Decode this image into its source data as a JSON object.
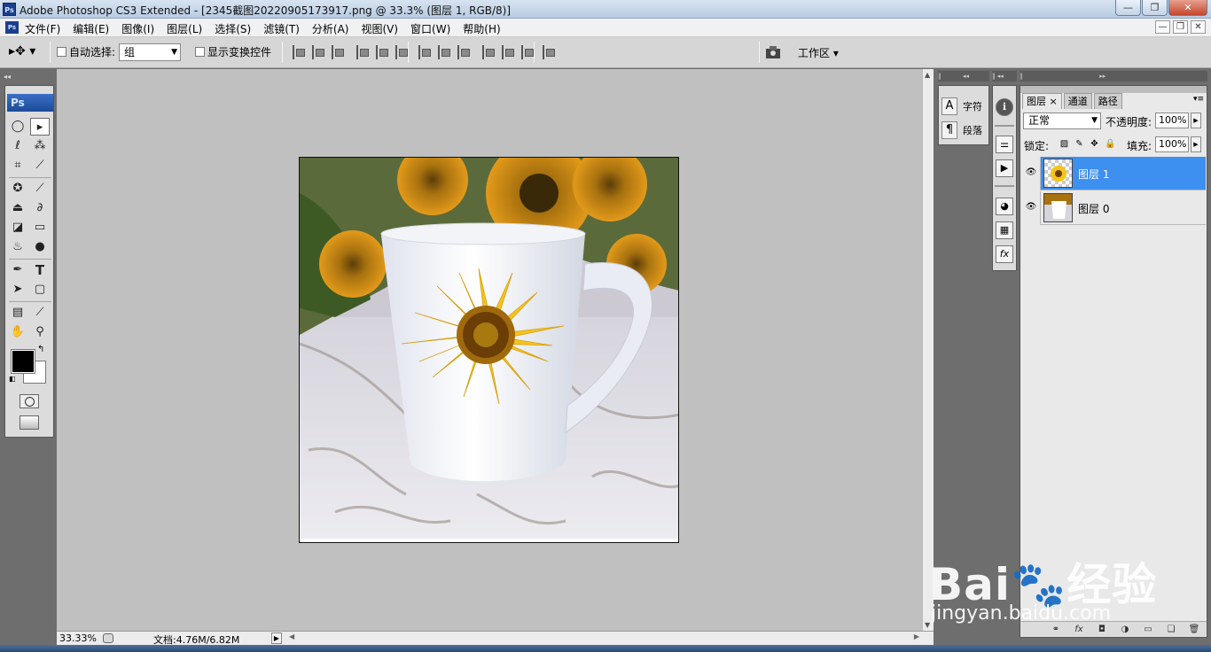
{
  "window": {
    "title": "Adobe Photoshop CS3 Extended - [2345截图20220905173917.png @ 33.3% (图层 1, RGB/8)]",
    "app_badge": "Ps",
    "minimize_label": "—",
    "restore_label": "❐",
    "close_label": "✕"
  },
  "menubar": {
    "items": [
      "文件(F)",
      "编辑(E)",
      "图像(I)",
      "图层(L)",
      "选择(S)",
      "滤镜(T)",
      "分析(A)",
      "视图(V)",
      "窗口(W)",
      "帮助(H)"
    ],
    "doc_minimize": "—",
    "doc_restore": "❐",
    "doc_close": "✕"
  },
  "options": {
    "tool_glyph": "▸✥ ▾",
    "auto_select_label": "自动选择:",
    "auto_select_value": "组",
    "show_transform_label": "显示变换控件",
    "workspace_label": "工作区 ▾"
  },
  "toolbox": {
    "logo": "Ps",
    "tools": [
      {
        "name": "marquee",
        "glyph": "◯"
      },
      {
        "name": "move",
        "glyph": "▸"
      },
      {
        "name": "lasso",
        "glyph": "ℓ"
      },
      {
        "name": "magic-wand",
        "glyph": "⁂"
      },
      {
        "name": "crop",
        "glyph": "⌗"
      },
      {
        "name": "slice",
        "glyph": "⟋"
      },
      {
        "name": "healing",
        "glyph": "✪"
      },
      {
        "name": "brush",
        "glyph": "⟋"
      },
      {
        "name": "clone-stamp",
        "glyph": "⏏"
      },
      {
        "name": "history-brush",
        "glyph": "∂"
      },
      {
        "name": "eraser",
        "glyph": "◪"
      },
      {
        "name": "gradient",
        "glyph": "▭"
      },
      {
        "name": "blur",
        "glyph": "♨"
      },
      {
        "name": "dodge",
        "glyph": "●"
      },
      {
        "name": "pen",
        "glyph": "✒"
      },
      {
        "name": "type",
        "glyph": "T"
      },
      {
        "name": "path-select",
        "glyph": "➤"
      },
      {
        "name": "shape",
        "glyph": "▢"
      },
      {
        "name": "notes",
        "glyph": "▤"
      },
      {
        "name": "eyedropper",
        "glyph": "⟋"
      },
      {
        "name": "hand",
        "glyph": "✋"
      },
      {
        "name": "zoom",
        "glyph": "⚲"
      }
    ],
    "swap_glyph": "↰",
    "default_glyph": "◧",
    "foreground_color": "#000000",
    "background_color": "#ffffff"
  },
  "status": {
    "zoom": "33.33%",
    "doc_size": "文档:4.76M/6.82M",
    "arrow": "▶"
  },
  "char_panel": {
    "character_label": "字符",
    "paragraph_label": "段落",
    "character_glyph": "A",
    "paragraph_glyph": "¶"
  },
  "icon_strip": {
    "info_glyph": "ℹ",
    "glyphs": [
      "⚌",
      "▶",
      "◕",
      "▦",
      "fx"
    ]
  },
  "layers": {
    "tabs": [
      "图层 ×",
      "通道",
      "路径"
    ],
    "blend_mode": "正常",
    "opacity_label": "不透明度:",
    "opacity_value": "100%",
    "lock_label": "锁定:",
    "fill_label": "填充:",
    "fill_value": "100%",
    "items": [
      {
        "name": "图层 1",
        "selected": true
      },
      {
        "name": "图层 0",
        "selected": false
      }
    ],
    "bottom_glyphs": [
      "⚭",
      "fx",
      "◘",
      "◑",
      "▭",
      "❏",
      "🗑"
    ]
  },
  "watermark": {
    "brand": "Bai🐾经验",
    "url": "jingyan.baidu.com"
  },
  "colors": {
    "canvas_bg": "#c0c0c0",
    "selection": "#3d8ff0",
    "sunflower": "#f5c419"
  }
}
